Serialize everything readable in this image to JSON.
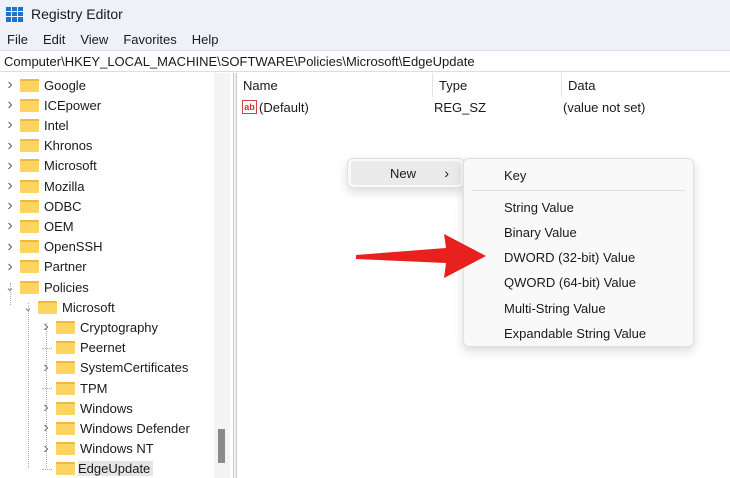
{
  "window": {
    "title": "Registry Editor"
  },
  "menu": [
    "File",
    "Edit",
    "View",
    "Favorites",
    "Help"
  ],
  "address": "Computer\\HKEY_LOCAL_MACHINE\\SOFTWARE\\Policies\\Microsoft\\EdgeUpdate",
  "tree": [
    {
      "label": "Google",
      "level": 0,
      "expander": "collapsed"
    },
    {
      "label": "ICEpower",
      "level": 0,
      "expander": "collapsed"
    },
    {
      "label": "Intel",
      "level": 0,
      "expander": "collapsed"
    },
    {
      "label": "Khronos",
      "level": 0,
      "expander": "collapsed"
    },
    {
      "label": "Microsoft",
      "level": 0,
      "expander": "collapsed"
    },
    {
      "label": "Mozilla",
      "level": 0,
      "expander": "collapsed"
    },
    {
      "label": "ODBC",
      "level": 0,
      "expander": "collapsed"
    },
    {
      "label": "OEM",
      "level": 0,
      "expander": "collapsed"
    },
    {
      "label": "OpenSSH",
      "level": 0,
      "expander": "collapsed"
    },
    {
      "label": "Partner",
      "level": 0,
      "expander": "collapsed"
    },
    {
      "label": "Policies",
      "level": 0,
      "expander": "expanded"
    },
    {
      "label": "Microsoft",
      "level": 1,
      "expander": "expanded"
    },
    {
      "label": "Cryptography",
      "level": 2,
      "expander": "collapsed"
    },
    {
      "label": "Peernet",
      "level": 2,
      "expander": "none"
    },
    {
      "label": "SystemCertificates",
      "level": 2,
      "expander": "collapsed"
    },
    {
      "label": "TPM",
      "level": 2,
      "expander": "none"
    },
    {
      "label": "Windows",
      "level": 2,
      "expander": "collapsed"
    },
    {
      "label": "Windows Defender",
      "level": 2,
      "expander": "collapsed"
    },
    {
      "label": "Windows NT",
      "level": 2,
      "expander": "collapsed"
    },
    {
      "label": "EdgeUpdate",
      "level": 2,
      "expander": "none",
      "selected": true
    }
  ],
  "columns": {
    "name": "Name",
    "type": "Type",
    "data": "Data"
  },
  "values": [
    {
      "name": "(Default)",
      "type": "REG_SZ",
      "data": "(value not set)"
    }
  ],
  "context_menu": {
    "new_label": "New",
    "submenu": [
      "Key",
      "String Value",
      "Binary Value",
      "DWORD (32-bit) Value",
      "QWORD (64-bit) Value",
      "Multi-String Value",
      "Expandable String Value"
    ]
  },
  "colors": {
    "arrow": "#e8201e",
    "folder": "#fcd462"
  }
}
